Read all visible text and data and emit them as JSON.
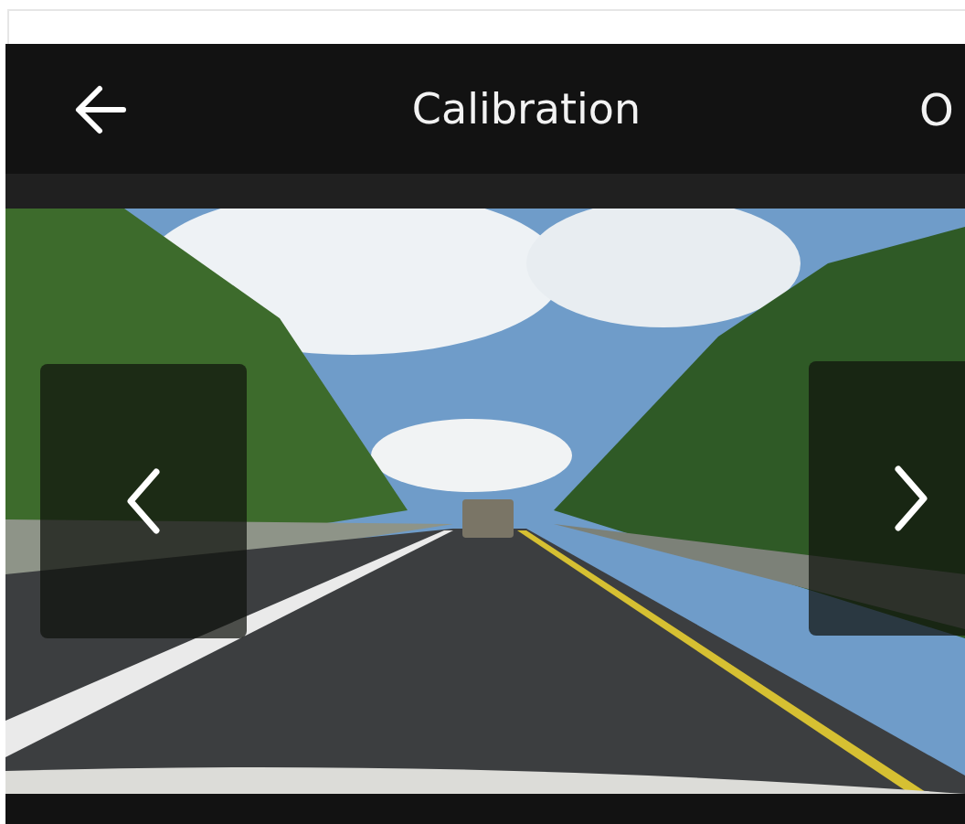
{
  "header": {
    "title": "Calibration",
    "action": "O"
  }
}
